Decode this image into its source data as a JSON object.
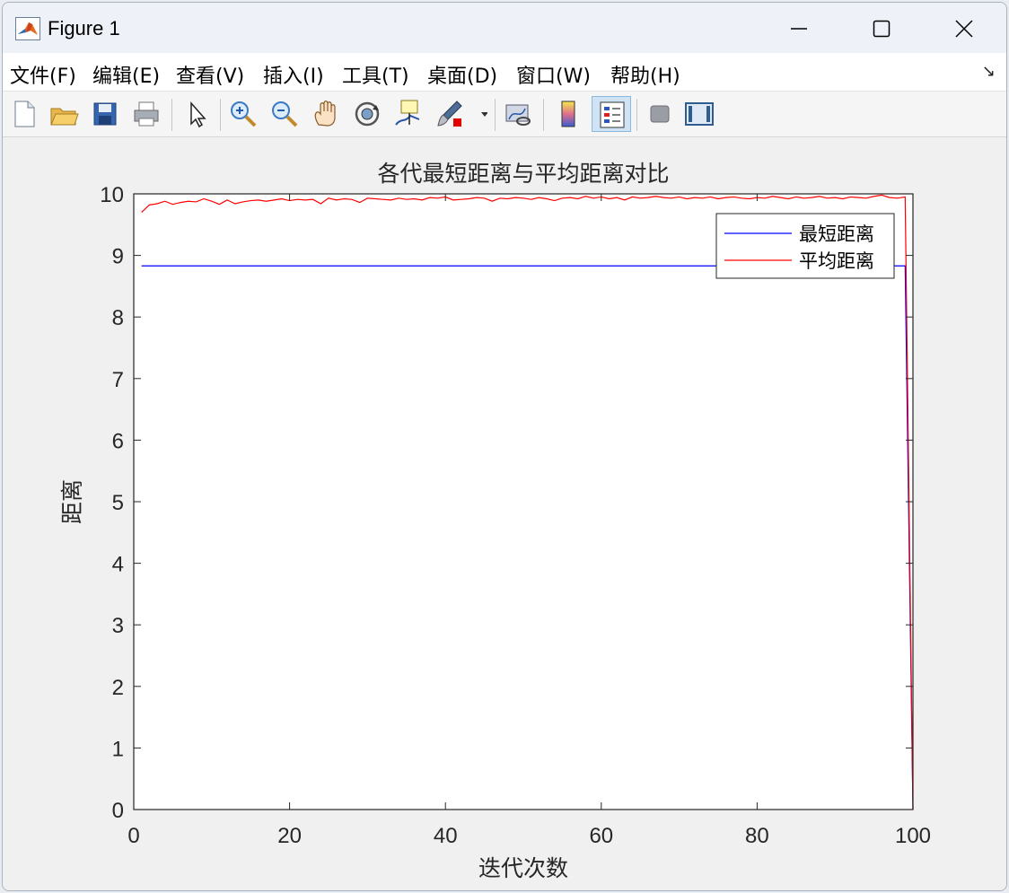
{
  "window": {
    "title": "Figure 1"
  },
  "menu": [
    "文件(F)",
    "编辑(E)",
    "查看(V)",
    "插入(I)",
    "工具(T)",
    "桌面(D)",
    "窗口(W)",
    "帮助(H)"
  ],
  "toolbar": {
    "tools": [
      "new-file-icon",
      "open-folder-icon",
      "save-icon",
      "print-icon",
      "pointer-icon",
      "zoom-in-icon",
      "zoom-out-icon",
      "pan-hand-icon",
      "rotate-3d-icon",
      "data-cursor-icon",
      "brush-icon",
      "link-plot-icon",
      "colorbar-icon",
      "legend-icon",
      "hide-plot-tools-icon",
      "show-plot-tools-icon"
    ]
  },
  "colors": {
    "series_min": "#0000ff",
    "series_avg": "#ff0000",
    "axes_bg": "#ffffff",
    "figure_bg": "#f0f0f0"
  },
  "chart_data": {
    "type": "line",
    "title": "各代最短距离与平均距离对比",
    "xlabel": "迭代次数",
    "ylabel": "距离",
    "xlim": [
      0,
      100
    ],
    "ylim": [
      0,
      10
    ],
    "xticks": [
      0,
      20,
      40,
      60,
      80,
      100
    ],
    "yticks": [
      0,
      1,
      2,
      3,
      4,
      5,
      6,
      7,
      8,
      9,
      10
    ],
    "grid": false,
    "legend_position": "top-right",
    "series": [
      {
        "name": "最短距离",
        "color": "#0000ff",
        "x": [
          1,
          2,
          3,
          4,
          5,
          6,
          7,
          8,
          9,
          10,
          11,
          12,
          13,
          14,
          15,
          16,
          17,
          18,
          19,
          20,
          21,
          22,
          23,
          24,
          25,
          26,
          27,
          28,
          29,
          30,
          31,
          32,
          33,
          34,
          35,
          36,
          37,
          38,
          39,
          40,
          41,
          42,
          43,
          44,
          45,
          46,
          47,
          48,
          49,
          50,
          51,
          52,
          53,
          54,
          55,
          56,
          57,
          58,
          59,
          60,
          61,
          62,
          63,
          64,
          65,
          66,
          67,
          68,
          69,
          70,
          71,
          72,
          73,
          74,
          75,
          76,
          77,
          78,
          79,
          80,
          81,
          82,
          83,
          84,
          85,
          86,
          87,
          88,
          89,
          90,
          91,
          92,
          93,
          94,
          95,
          96,
          97,
          98,
          99,
          100
        ],
        "y": [
          8.83,
          8.83,
          8.83,
          8.83,
          8.83,
          8.83,
          8.83,
          8.83,
          8.83,
          8.83,
          8.83,
          8.83,
          8.83,
          8.83,
          8.83,
          8.83,
          8.83,
          8.83,
          8.83,
          8.83,
          8.83,
          8.83,
          8.83,
          8.83,
          8.83,
          8.83,
          8.83,
          8.83,
          8.83,
          8.83,
          8.83,
          8.83,
          8.83,
          8.83,
          8.83,
          8.83,
          8.83,
          8.83,
          8.83,
          8.83,
          8.83,
          8.83,
          8.83,
          8.83,
          8.83,
          8.83,
          8.83,
          8.83,
          8.83,
          8.83,
          8.83,
          8.83,
          8.83,
          8.83,
          8.83,
          8.83,
          8.83,
          8.83,
          8.83,
          8.83,
          8.83,
          8.83,
          8.83,
          8.83,
          8.83,
          8.83,
          8.83,
          8.83,
          8.83,
          8.83,
          8.83,
          8.83,
          8.83,
          8.83,
          8.83,
          8.83,
          8.83,
          8.83,
          8.83,
          8.83,
          8.83,
          8.83,
          8.83,
          8.83,
          8.83,
          8.83,
          8.83,
          8.83,
          8.83,
          8.83,
          8.83,
          8.83,
          8.83,
          8.83,
          8.83,
          8.83,
          8.83,
          8.83,
          8.83,
          0
        ]
      },
      {
        "name": "平均距离",
        "color": "#ff0000",
        "x": [
          1,
          2,
          3,
          4,
          5,
          6,
          7,
          8,
          9,
          10,
          11,
          12,
          13,
          14,
          15,
          16,
          17,
          18,
          19,
          20,
          21,
          22,
          23,
          24,
          25,
          26,
          27,
          28,
          29,
          30,
          31,
          32,
          33,
          34,
          35,
          36,
          37,
          38,
          39,
          40,
          41,
          42,
          43,
          44,
          45,
          46,
          47,
          48,
          49,
          50,
          51,
          52,
          53,
          54,
          55,
          56,
          57,
          58,
          59,
          60,
          61,
          62,
          63,
          64,
          65,
          66,
          67,
          68,
          69,
          70,
          71,
          72,
          73,
          74,
          75,
          76,
          77,
          78,
          79,
          80,
          81,
          82,
          83,
          84,
          85,
          86,
          87,
          88,
          89,
          90,
          91,
          92,
          93,
          94,
          95,
          96,
          97,
          98,
          99,
          100
        ],
        "y": [
          9.7,
          9.82,
          9.84,
          9.88,
          9.83,
          9.86,
          9.88,
          9.87,
          9.92,
          9.88,
          9.83,
          9.9,
          9.84,
          9.87,
          9.89,
          9.9,
          9.88,
          9.9,
          9.92,
          9.89,
          9.91,
          9.9,
          9.91,
          9.84,
          9.93,
          9.9,
          9.92,
          9.91,
          9.86,
          9.93,
          9.92,
          9.91,
          9.9,
          9.93,
          9.91,
          9.92,
          9.9,
          9.94,
          9.93,
          9.95,
          9.9,
          9.91,
          9.92,
          9.94,
          9.93,
          9.88,
          9.93,
          9.92,
          9.94,
          9.93,
          9.91,
          9.94,
          9.92,
          9.89,
          9.93,
          9.94,
          9.92,
          9.96,
          9.93,
          9.95,
          9.92,
          9.94,
          9.9,
          9.95,
          9.93,
          9.94,
          9.96,
          9.94,
          9.93,
          9.95,
          9.92,
          9.94,
          9.93,
          9.95,
          9.92,
          9.94,
          9.95,
          9.93,
          9.92,
          9.94,
          9.93,
          9.96,
          9.94,
          9.92,
          9.95,
          9.93,
          9.94,
          9.96,
          9.93,
          9.94,
          9.92,
          9.95,
          9.94,
          9.93,
          9.96,
          9.98,
          9.94,
          9.93,
          9.95,
          0
        ]
      }
    ]
  }
}
